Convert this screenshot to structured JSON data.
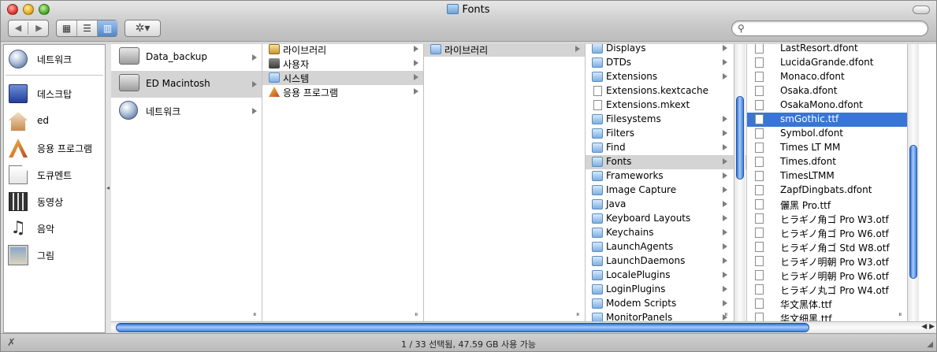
{
  "window": {
    "title": "Fonts"
  },
  "toolbar": {
    "back_label": "◀",
    "forward_label": "▶",
    "view_icon_label": "▦",
    "view_list_label": "☰",
    "view_column_label": "▥",
    "action_label": "✲▾",
    "search_value": "",
    "search_placeholder": ""
  },
  "sidebar": {
    "items": [
      {
        "label": "네트워크",
        "icon": "network-globe-icon"
      },
      {
        "label": "데스크탑",
        "icon": "desktop-icon"
      },
      {
        "label": "ed",
        "icon": "home-icon"
      },
      {
        "label": "응용 프로그램",
        "icon": "applications-icon"
      },
      {
        "label": "도큐멘트",
        "icon": "documents-icon"
      },
      {
        "label": "동영상",
        "icon": "movies-icon"
      },
      {
        "label": "음악",
        "icon": "music-icon"
      },
      {
        "label": "그림",
        "icon": "pictures-icon"
      }
    ]
  },
  "columns": {
    "volumes": [
      {
        "label": "Data_backup",
        "type": "disk"
      },
      {
        "label": "ED Macintosh",
        "type": "disk",
        "selected": true
      },
      {
        "label": "네트워크",
        "type": "network"
      }
    ],
    "root": [
      {
        "label": "라이브러리",
        "type": "library"
      },
      {
        "label": "사용자",
        "type": "user"
      },
      {
        "label": "시스템",
        "type": "folder",
        "selected": true
      },
      {
        "label": "응용 프로그램",
        "type": "apps"
      }
    ],
    "system": [
      {
        "label": "라이브러리",
        "type": "folder",
        "selected": true
      }
    ],
    "library": [
      "Displays",
      "DTDs",
      "Extensions",
      "Extensions.kextcache",
      "Extensions.mkext",
      "Filesystems",
      "Filters",
      "Find",
      "Fonts",
      "Frameworks",
      "Image Capture",
      "Java",
      "Keyboard Layouts",
      "Keychains",
      "LaunchAgents",
      "LaunchDaemons",
      "LocalePlugins",
      "LoginPlugins",
      "Modem Scripts",
      "MonitorPanels"
    ],
    "library_files": [
      "Extensions.kextcache",
      "Extensions.mkext"
    ],
    "library_selected": "Fonts",
    "fonts": [
      "LastResort.dfont",
      "LucidaGrande.dfont",
      "Monaco.dfont",
      "Osaka.dfont",
      "OsakaMono.dfont",
      "smGothic.ttf",
      "Symbol.dfont",
      "Times LT MM",
      "Times.dfont",
      "TimesLTMM",
      "ZapfDingbats.dfont",
      "儷黑 Pro.ttf",
      "ヒラギノ角ゴ Pro W3.otf",
      "ヒラギノ角ゴ Pro W6.otf",
      "ヒラギノ角ゴ Std W8.otf",
      "ヒラギノ明朝 Pro W3.otf",
      "ヒラギノ明朝 Pro W6.otf",
      "ヒラギノ丸ゴ Pro W4.otf",
      "华文黑体.ttf",
      "华文细黑.ttf"
    ],
    "fonts_selected": "smGothic.ttf"
  },
  "status": {
    "text": "1 / 33 선택됨, 47.59 GB 사용 가능"
  },
  "colors": {
    "selection": "#3875d7",
    "inactive_selection": "#d4d4d4"
  }
}
